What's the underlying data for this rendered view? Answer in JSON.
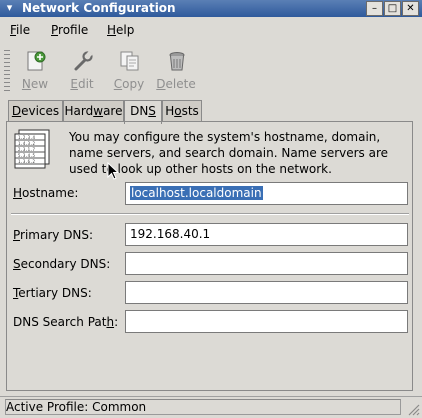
{
  "window": {
    "title": "Network Configuration",
    "menu_glyph": "▾",
    "min_glyph": "–",
    "max_glyph": "□",
    "close_glyph": "✕"
  },
  "menubar": {
    "file": {
      "mnemonic": "F",
      "rest": "ile"
    },
    "profile": {
      "mnemonic": "P",
      "rest": "rofile"
    },
    "help": {
      "mnemonic": "H",
      "rest": "elp"
    }
  },
  "toolbar": {
    "new": {
      "mnemonic": "N",
      "rest": "ew",
      "icon": "new-icon"
    },
    "edit": {
      "mnemonic": "E",
      "rest": "dit",
      "icon": "wrench-icon"
    },
    "copy": {
      "mnemonic": "C",
      "rest": "opy",
      "icon": "copy-icon"
    },
    "delete": {
      "mnemonic": "D",
      "rest": "elete",
      "icon": "trash-icon"
    }
  },
  "tabs": {
    "devices": {
      "mnemonic": "D",
      "rest": "evices"
    },
    "hardware": {
      "pre": "Hard",
      "mnemonic": "w",
      "rest": "are"
    },
    "dns": {
      "pre": "DN",
      "mnemonic": "S",
      "rest": ""
    },
    "hosts": {
      "pre": "H",
      "mnemonic": "o",
      "rest": "sts"
    },
    "active": "dns"
  },
  "dns": {
    "info": "You may configure the system's hostname, domain, name servers, and search domain. Name servers are used to look up other hosts on the network.",
    "hostname_label": {
      "mnemonic": "H",
      "rest": "ostname:"
    },
    "hostname_value": "localhost.localdomain",
    "primary_label": {
      "mnemonic": "P",
      "rest": "rimary DNS:"
    },
    "primary_value": "192.168.40.1",
    "secondary_label": {
      "mnemonic": "S",
      "rest": "econdary DNS:"
    },
    "secondary_value": "",
    "tertiary_label": {
      "mnemonic": "T",
      "rest": "ertiary DNS:"
    },
    "tertiary_value": "",
    "search_label": {
      "pre": "DNS Search Pat",
      "mnemonic": "h",
      "rest": ":"
    },
    "search_value": ""
  },
  "status": {
    "text": "Active Profile: Common"
  }
}
